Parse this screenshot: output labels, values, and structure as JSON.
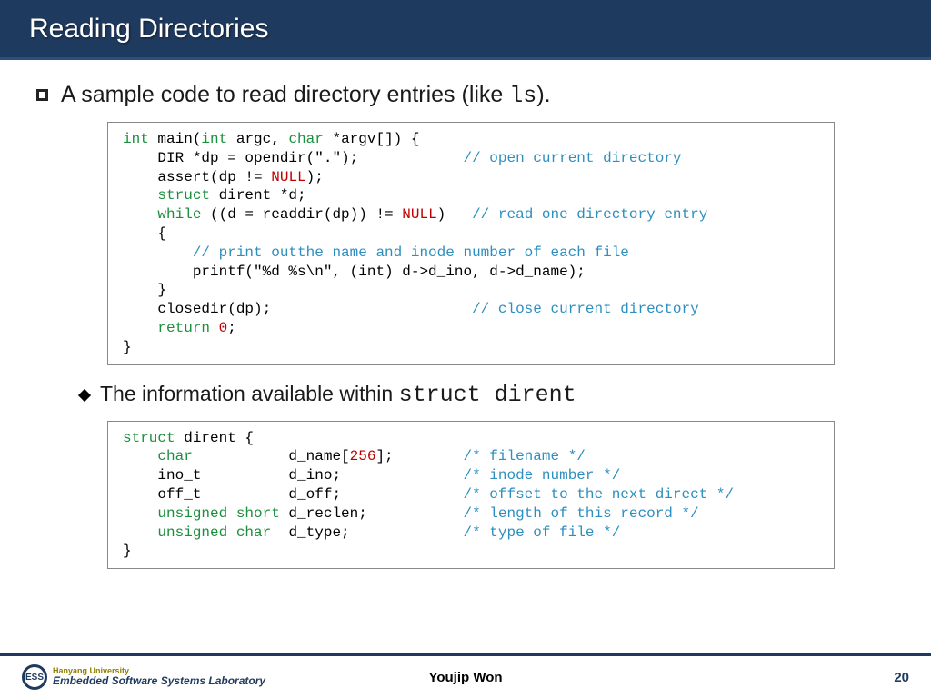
{
  "title": "Reading Directories",
  "bullet": {
    "prefix": "A sample code to read directory entries (like ",
    "mono": "ls",
    "suffix": ")."
  },
  "code1": {
    "l1a": "int",
    "l1b": " main(",
    "l1c": "int",
    "l1d": " argc, ",
    "l1e": "char",
    "l1f": " *argv[]) {",
    "l2a": "    DIR *dp = opendir(\".\");            ",
    "l2b": "// open current directory",
    "l3a": "    assert(dp != ",
    "l3b": "NULL",
    "l3c": ");",
    "l4a": "    struct",
    "l4b": " dirent *d;",
    "l5a": "    while",
    "l5b": " ((d = readdir(dp)) != ",
    "l5c": "NULL",
    "l5d": ")   ",
    "l5e": "// read one directory entry",
    "l6": "    {",
    "l7": "        // print outthe name and inode number of each file",
    "l8": "        printf(\"%d %s\\n\", (int) d->d_ino, d->d_name);",
    "l9": "    }",
    "l10a": "    closedir(dp);                       ",
    "l10b": "// close current directory",
    "l11a": "    return ",
    "l11b": "0",
    "l11c": ";",
    "l12": "}"
  },
  "subbullet": {
    "prefix": "The information available within ",
    "mono": "struct dirent"
  },
  "code2": {
    "l1a": "struct",
    "l1b": " dirent {",
    "l2a": "    char",
    "l2b": "           d_name[",
    "l2c": "256",
    "l2d": "];        ",
    "l2e": "/* filename */",
    "l3a": "    ino_t          d_ino;              ",
    "l3b": "/* inode number */",
    "l4a": "    off_t          d_off;              ",
    "l4b": "/* offset to the next direct */",
    "l5a": "    unsigned short",
    "l5b": " d_reclen;           ",
    "l5c": "/* length of this record */",
    "l6a": "    unsigned char",
    "l6b": "  d_type;             ",
    "l6c": "/* type of file */",
    "l7": "}"
  },
  "footer": {
    "univ": "Hanyang University",
    "lab": "Embedded Software Systems Laboratory",
    "author": "Youjip Won",
    "page": "20"
  }
}
